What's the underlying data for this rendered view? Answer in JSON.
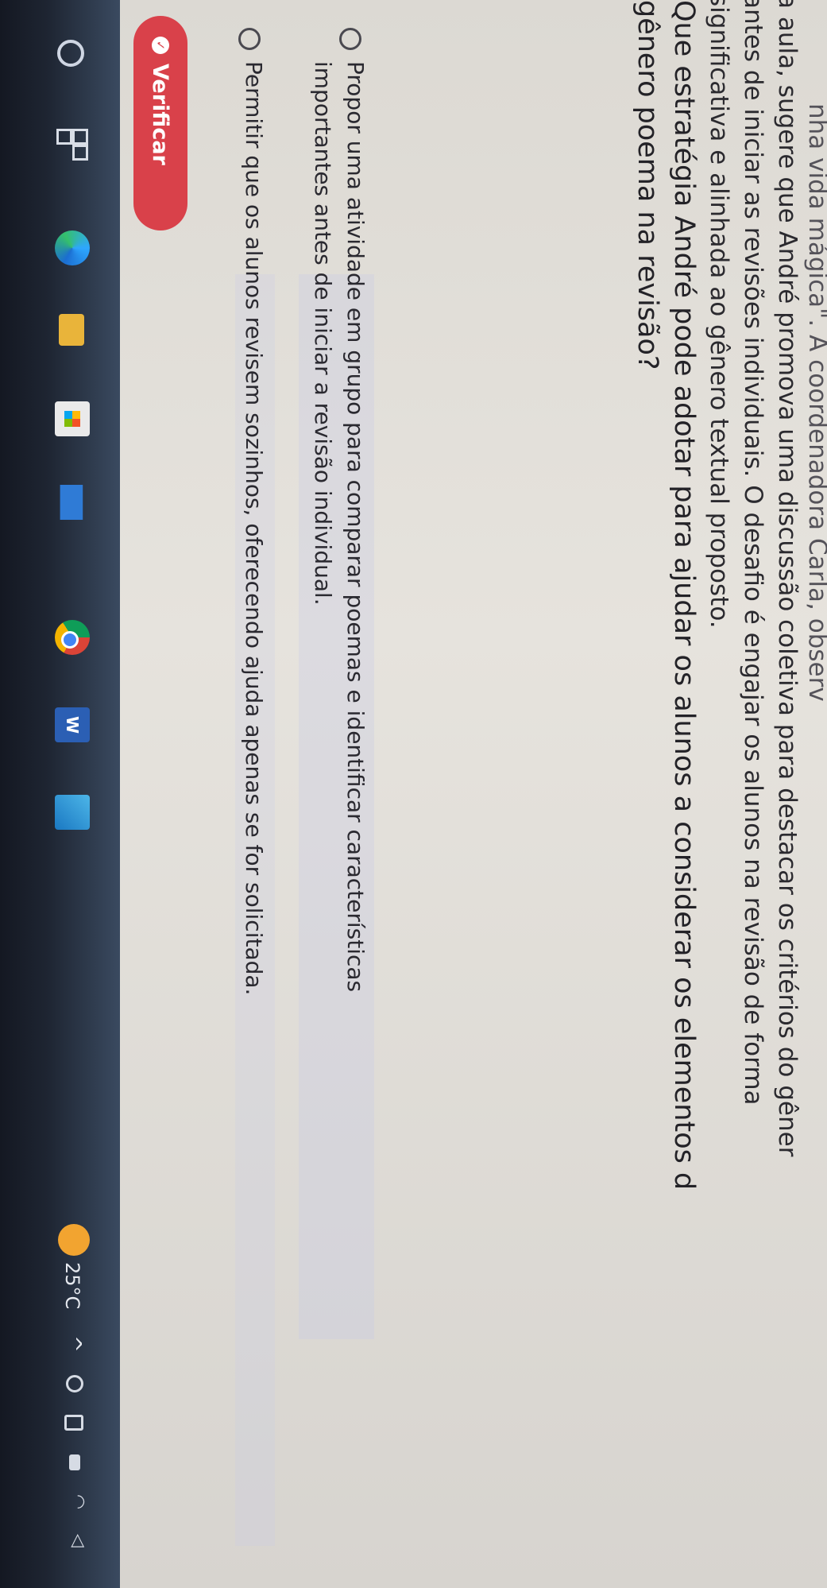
{
  "passage": {
    "line1": "nha vida mágica\". A coordenadora Carla, observ",
    "line2": "a aula, sugere que André promova uma discussão coletiva para destacar os critérios do gêner",
    "line3": "antes de iniciar as revisões individuais. O desafio é engajar os alunos na revisão de forma",
    "line4": "significativa e alinhada ao gênero textual proposto."
  },
  "question": {
    "line1": "Que estratégia André pode adotar para ajudar os alunos a considerar os elementos d",
    "line2": "gênero poema na revisão?"
  },
  "options": [
    {
      "line1": "Propor uma atividade em grupo para comparar poemas e identificar características",
      "line2": "importantes antes de iniciar a revisão individual."
    },
    {
      "line1": "Permitir que os alunos revisem sozinhos, oferecendo ajuda apenas se for solicitada."
    }
  ],
  "verify_button": {
    "label": "Verificar",
    "color": "#d9414a"
  },
  "taskbar": {
    "icons": [
      "search-icon",
      "task-view-icon",
      "edge-icon",
      "file-explorer-icon",
      "store-icon",
      "mail-icon",
      "chrome-icon",
      "word-icon",
      "paint-icon"
    ],
    "weather_temp": "25°C",
    "tray_chevron": "^",
    "tray_icons": [
      "meet-icon",
      "battery-icon",
      "display-icon",
      "wifi-icon",
      "volume-icon"
    ]
  }
}
